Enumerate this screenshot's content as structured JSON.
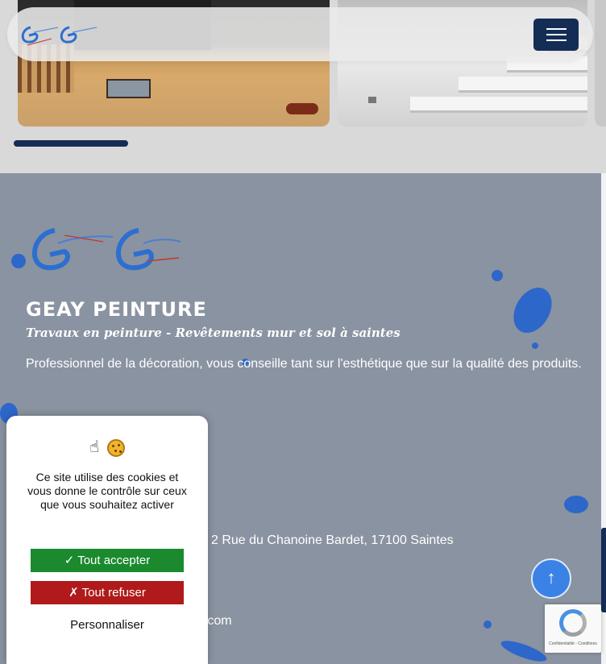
{
  "header": {
    "logo_alt": "Geay Peinture logo",
    "menu_icon": "hamburger-icon"
  },
  "gallery": {
    "photos": [
      "photo-interior-stairs-wood-floor",
      "photo-white-staircase"
    ]
  },
  "footer": {
    "brand_title": "GEAY PEINTURE",
    "tagline": "Travaux en peinture - Revêtements mur et sol à saintes",
    "description": "Professionnel de la décoration, vous conseille tant sur l'esthétique que sur la qualité des produits.",
    "address": "2 Rue du Chanoine Bardet, 17100 Saintes",
    "email_fragment": "e.com"
  },
  "cookie": {
    "icons": [
      "pointing-hand-icon",
      "cookie-icon"
    ],
    "message": "Ce site utilise des cookies et vous donne le contrôle sur ceux que vous souhaitez activer",
    "accept_label": "✓ Tout accepter",
    "refuse_label": "✗ Tout refuser",
    "customize_label": "Personnaliser"
  },
  "scroll_top": {
    "icon": "arrow-up-icon",
    "glyph": "↑"
  },
  "recaptcha": {
    "text": "Confidentialité - Conditions"
  },
  "colors": {
    "navy": "#132d54",
    "footer_bg": "#8a93a1",
    "accept_green": "#1b8a2e",
    "refuse_red": "#b01a1a",
    "scroll_top_blue": "#3b82e6"
  }
}
